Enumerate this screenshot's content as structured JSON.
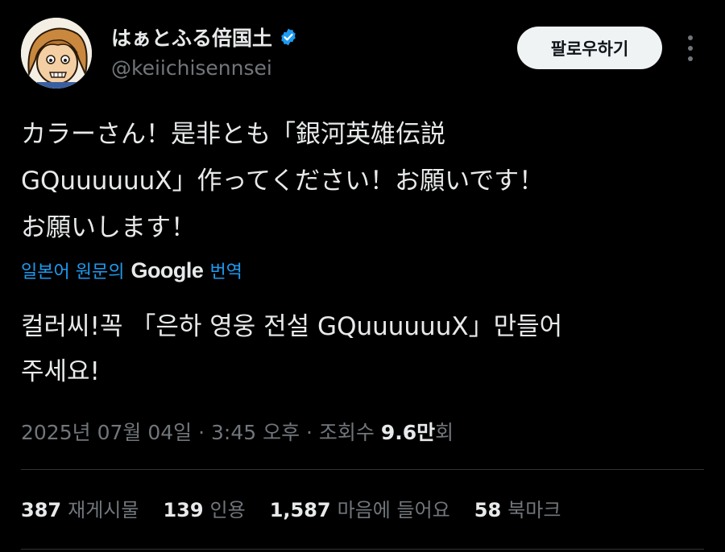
{
  "author": {
    "display_name": "はぁとふる倍国土",
    "handle": "@keiichisennsei"
  },
  "follow_label": "팔로우하기",
  "tweet": {
    "text": "カラーさん！是非とも「銀河英雄伝説\nGQuuuuuuX」作ってください！お願いです！\nお願いします！"
  },
  "translation": {
    "prefix": "일본어 원문의",
    "google": "Google",
    "suffix": "번역",
    "text": "컬러씨!꼭 「은하 영웅 전설 GQuuuuuuX」만들어\n주세요!"
  },
  "meta": {
    "date": "2025년 07월 04일",
    "sep1": " · ",
    "time": "3:45 오후",
    "sep2": " · ",
    "views_label": "조회수 ",
    "views_num": "9.6만",
    "views_suffix": "회"
  },
  "stats": [
    {
      "num": "387",
      "label": "재게시물"
    },
    {
      "num": "139",
      "label": "인용"
    },
    {
      "num": "1,587",
      "label": "마음에 들어요"
    },
    {
      "num": "58",
      "label": "북마크"
    }
  ],
  "colors": {
    "accent": "#1d9bf0",
    "muted": "#71767b",
    "text": "#e7e9ea",
    "background": "#000000"
  },
  "icons": {
    "verified": "verified-badge-icon",
    "more": "more-dots-icon"
  }
}
